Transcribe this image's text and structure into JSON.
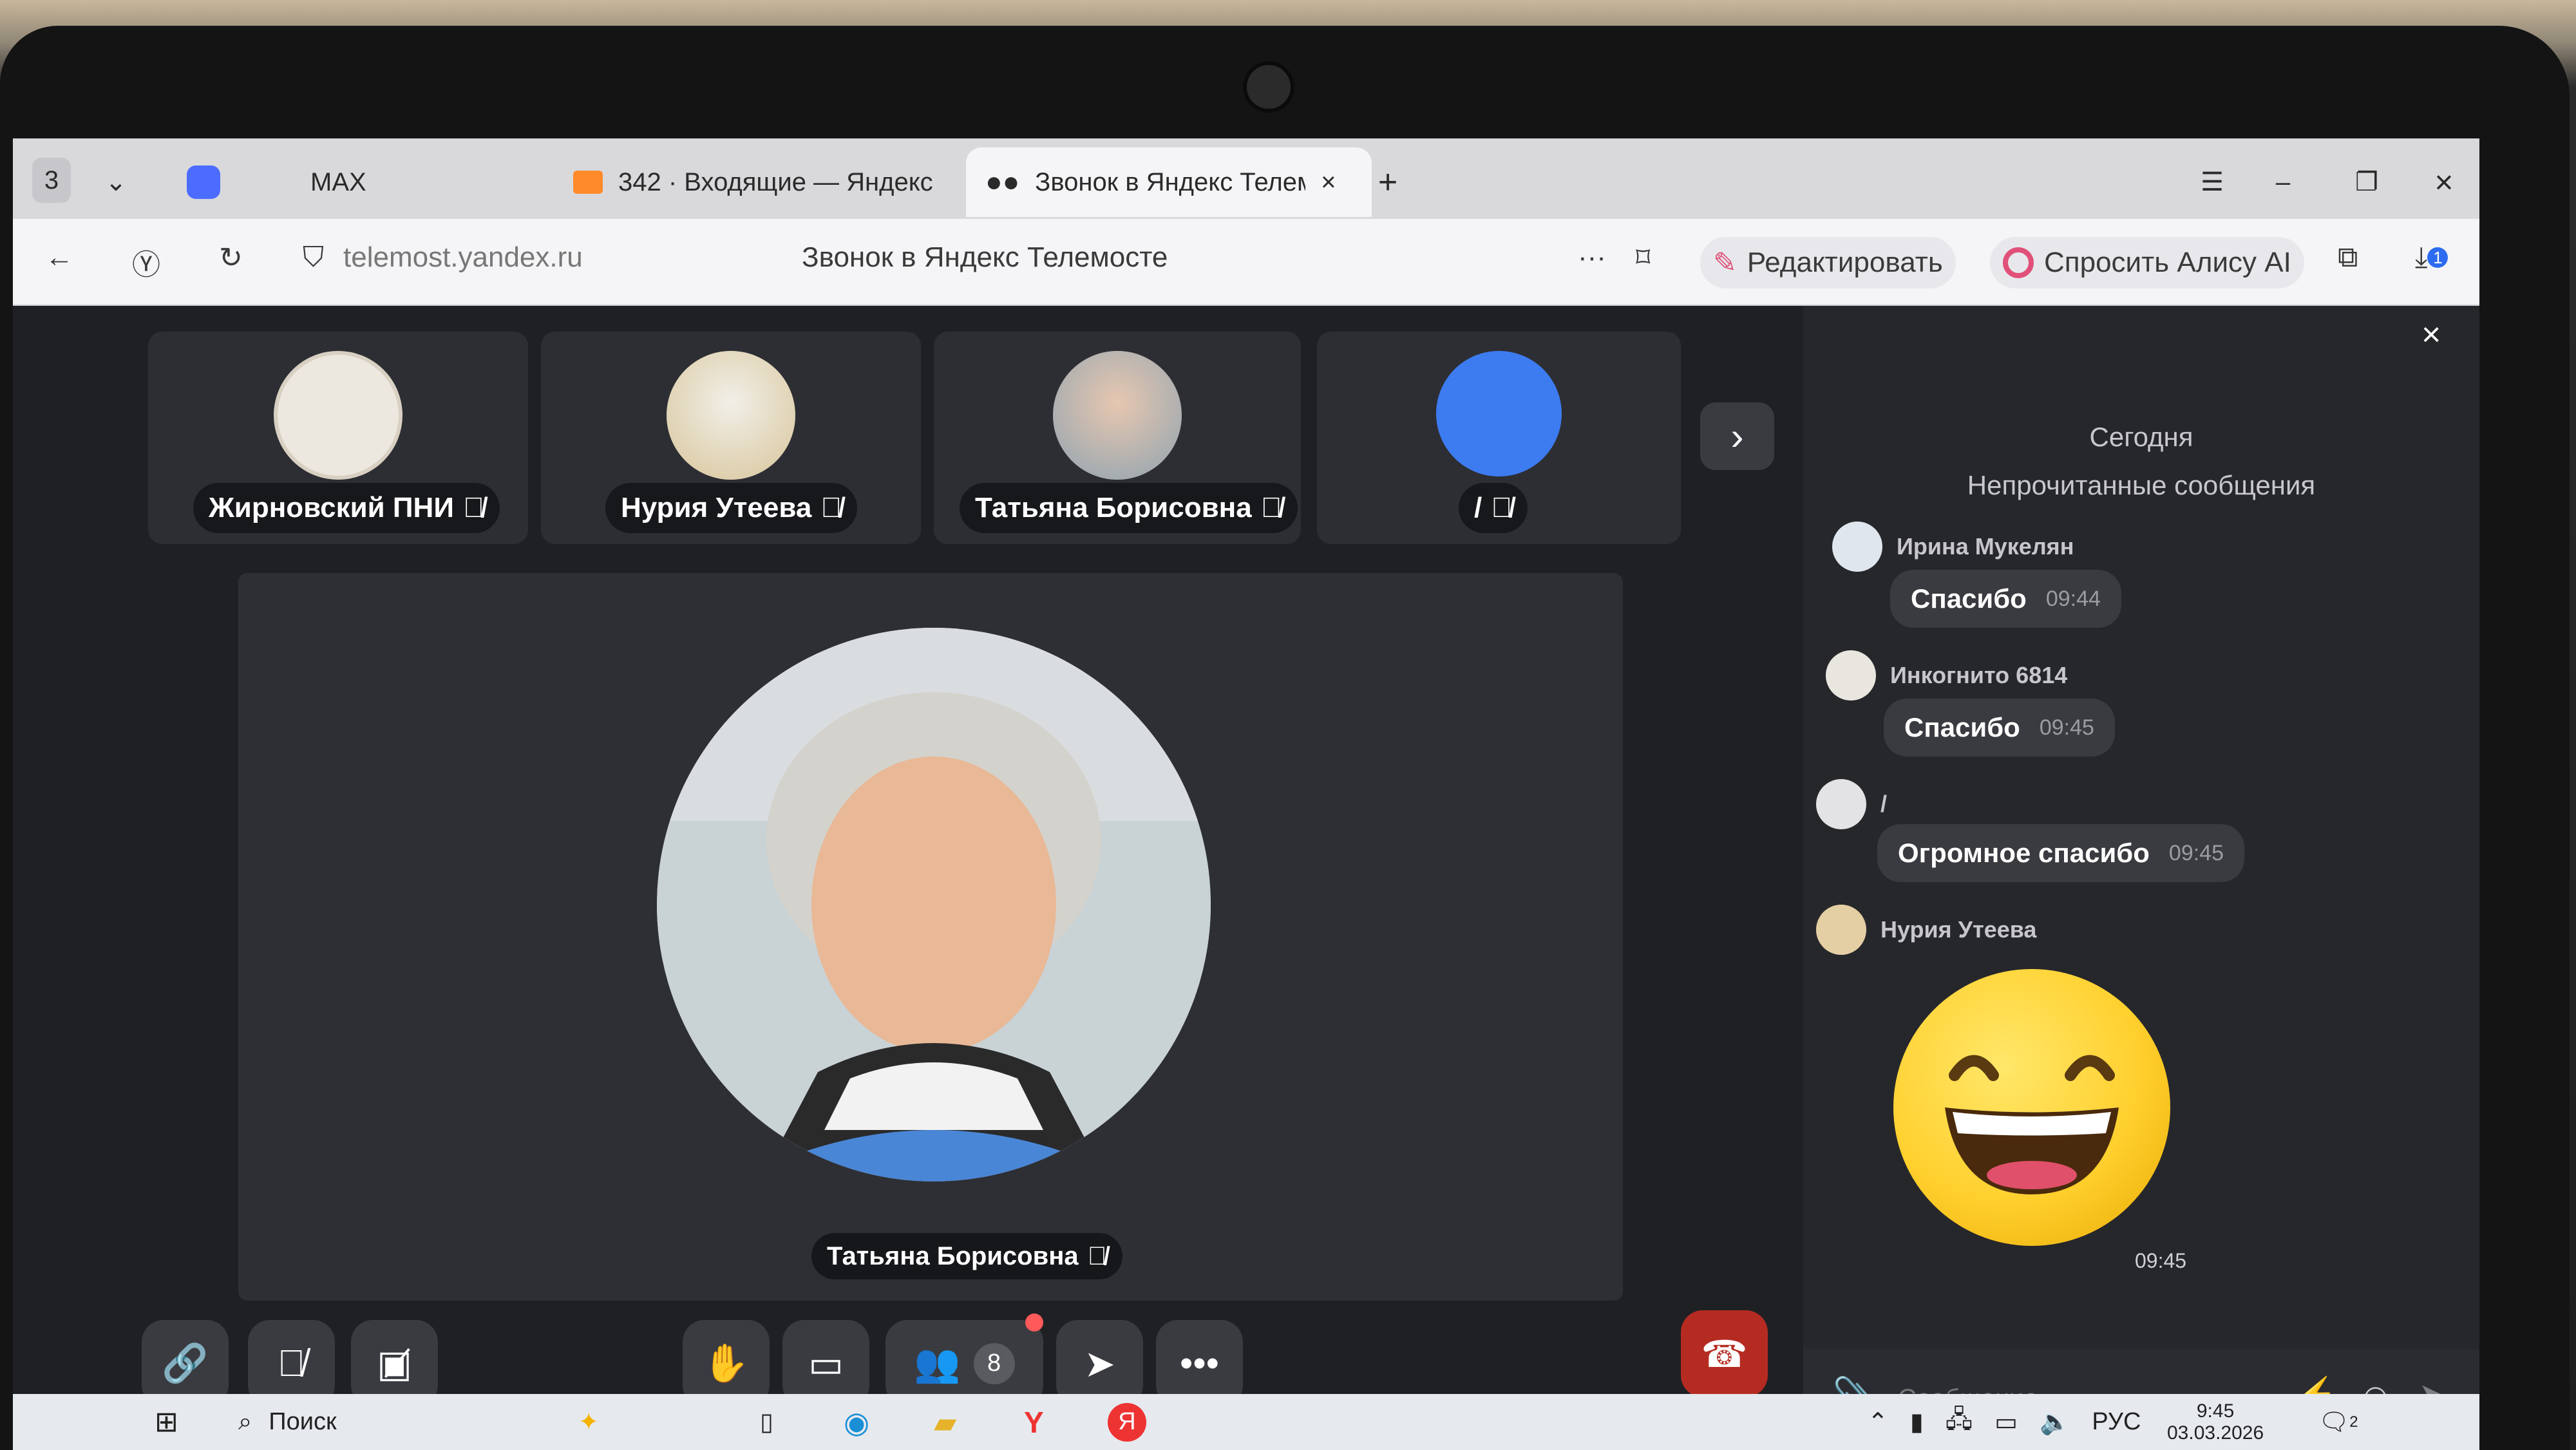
{
  "browser": {
    "tab_counter": "3",
    "tabs": [
      {
        "label": "MAX"
      },
      {
        "label": "342 · Входящие — Яндекс"
      },
      {
        "label": "Звонок в Яндекс Телем"
      }
    ],
    "url": "telemost.yandex.ru",
    "page_title": "Звонок в Яндекс Телемосте",
    "edit_label": "Редактировать",
    "alice_label": "Спросить Алису AI",
    "downloads_badge": "1"
  },
  "participants": [
    {
      "name": "Жирновский ПНИ",
      "avatar_color": "#e9e4dc"
    },
    {
      "name": "Нурия Утеева",
      "avatar_color": "#d9c9a8"
    },
    {
      "name": "Татьяна Борисовна",
      "avatar_color": "#b9c6cc"
    },
    {
      "name": "/",
      "avatar_color": "#3d7bf0"
    }
  ],
  "main_speaker": {
    "name": "Татьяна Борисовна"
  },
  "controls": {
    "participants_count": "8"
  },
  "chat": {
    "date_header": "Сегодня",
    "unread_header": "Непрочитанные сообщения",
    "messages": [
      {
        "author": "Ирина Мукелян",
        "text": "Спасибо",
        "time": "09:44"
      },
      {
        "author": "Инкогнито 6814",
        "text": "Спасибо",
        "time": "09:45"
      },
      {
        "author": "/",
        "text": "Огромное спасибо",
        "time": "09:45"
      },
      {
        "author": "Нурия Утеева",
        "text": "",
        "time": "09:45"
      }
    ],
    "input_placeholder": "Сообщение..."
  },
  "taskbar": {
    "search_label": "Поиск",
    "lang": "РУС",
    "time": "9:45",
    "date": "03.03.2026",
    "notifications": "2"
  },
  "colors": {
    "hangup": "#b52b22",
    "accent_blue": "#3d7bf0",
    "chat_bg": "#26272b"
  }
}
